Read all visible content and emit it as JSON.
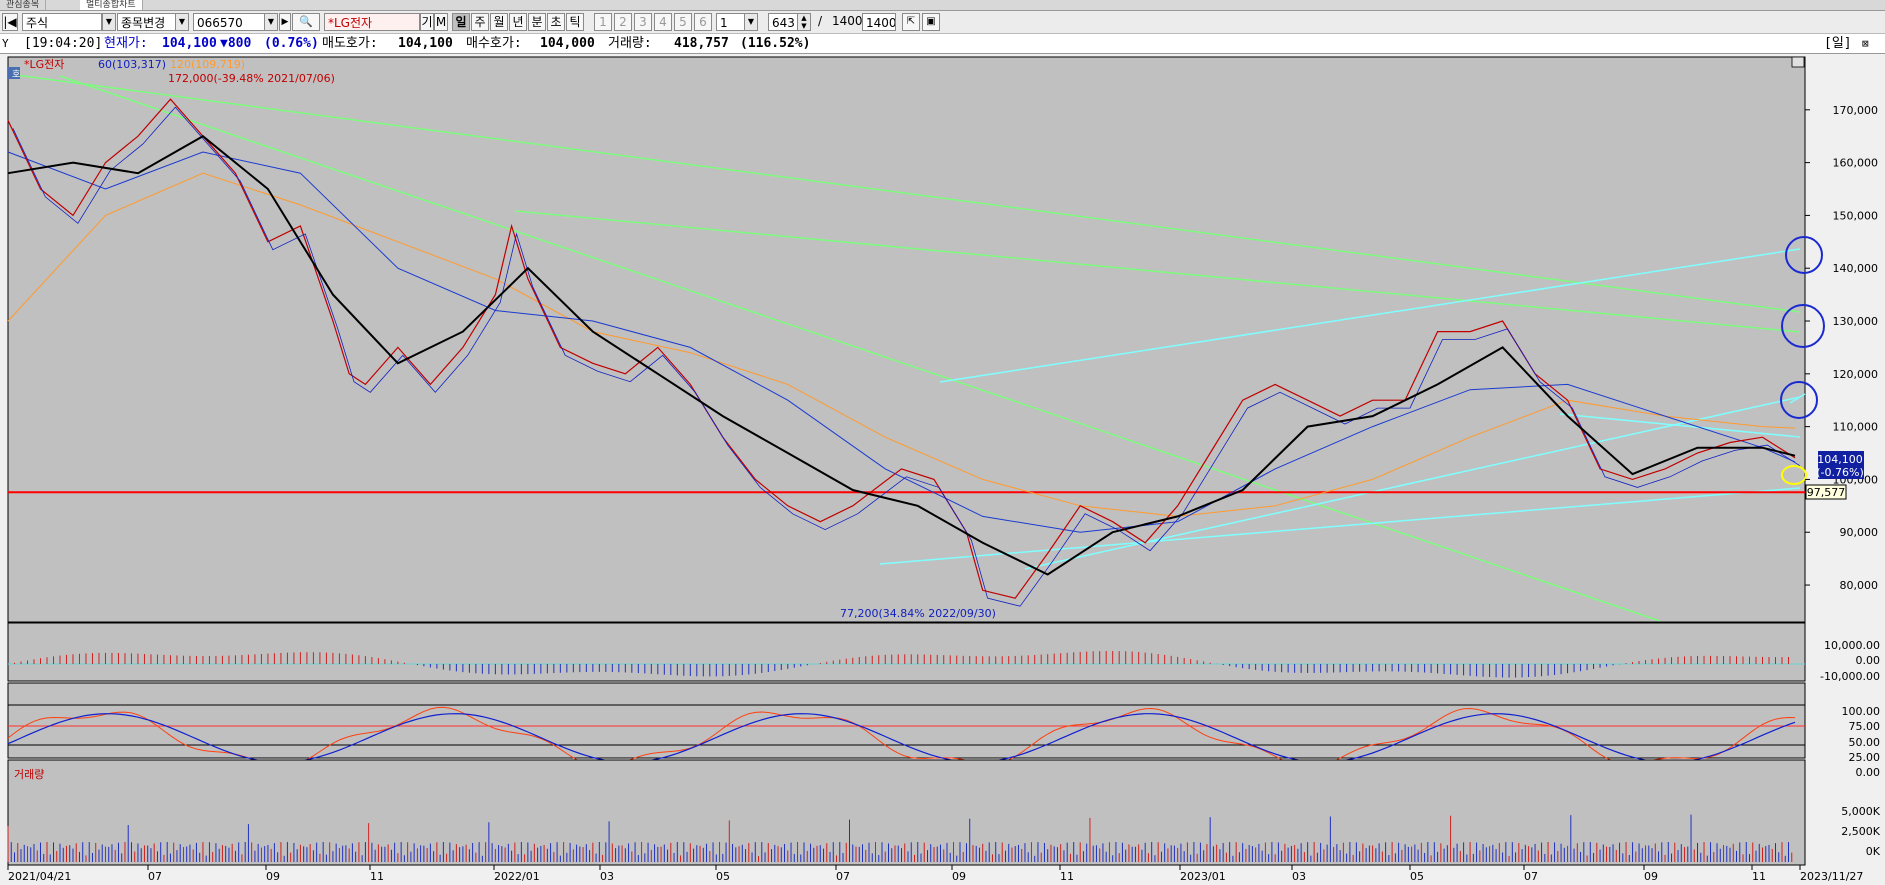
{
  "tabs": [
    "관심종목",
    "멀티종합차트"
  ],
  "toolbar": {
    "market": "주식",
    "change_label": "종목변경",
    "code": "066570",
    "stock_name": "*LG전자",
    "gi": "기",
    "m": "M",
    "periods": [
      "일",
      "주",
      "월",
      "년",
      "분",
      "초",
      "틱"
    ],
    "active_period": "일",
    "nums": [
      "1",
      "2",
      "3",
      "4",
      "5",
      "6"
    ],
    "unit": "1",
    "count": "643",
    "total": "1400",
    "box": "1400"
  },
  "info": {
    "time": "[19:04:20]",
    "price_label": "현재가:",
    "price": "104,100",
    "change": "▼800",
    "change_pct": "(0.76%)",
    "ask_label": "매도호가:",
    "ask": "104,100",
    "bid_label": "매수호가:",
    "bid": "104,000",
    "volume_label": "거래량:",
    "volume": "418,757",
    "volume_pct": "(116.52%)",
    "period_button": "[일]"
  },
  "chart_data": {
    "type": "line",
    "legend": {
      "name": "*LG전자",
      "ma60": "60(103,317)",
      "ma120": "120(109,719)",
      "hi": "172,000(-39.48% 2021/07/06)"
    },
    "hi_marker": "172,000(-39.48% 2021/07/06)",
    "lo_marker": "77,200(34.84% 2022/09/30)",
    "y_ticks": [
      "170,000",
      "160,000",
      "150,000",
      "140,000",
      "130,000",
      "120,000",
      "110,000",
      "100,000",
      "90,000",
      "80,000"
    ],
    "x_ticks": [
      "2021/04/21",
      "07",
      "09",
      "11",
      "2022/01",
      "03",
      "05",
      "07",
      "09",
      "11",
      "2023/01",
      "03",
      "05",
      "07",
      "09",
      "11",
      "2023/11/27"
    ],
    "current_price": "104,100",
    "current_pct": "(-0.76%)",
    "support_label": "97,577",
    "support_line": 97577,
    "ylim": [
      73000,
      180000
    ],
    "price_path": [
      [
        0,
        168000
      ],
      [
        10,
        155000
      ],
      [
        20,
        150000
      ],
      [
        30,
        160000
      ],
      [
        40,
        165000
      ],
      [
        50,
        172000
      ],
      [
        60,
        165000
      ],
      [
        70,
        158000
      ],
      [
        80,
        145000
      ],
      [
        90,
        148000
      ],
      [
        100,
        130000
      ],
      [
        105,
        120000
      ],
      [
        110,
        118000
      ],
      [
        120,
        125000
      ],
      [
        130,
        118000
      ],
      [
        140,
        125000
      ],
      [
        150,
        135000
      ],
      [
        155,
        148000
      ],
      [
        160,
        138000
      ],
      [
        170,
        125000
      ],
      [
        180,
        122000
      ],
      [
        190,
        120000
      ],
      [
        200,
        125000
      ],
      [
        210,
        118000
      ],
      [
        220,
        108000
      ],
      [
        230,
        100000
      ],
      [
        240,
        95000
      ],
      [
        250,
        92000
      ],
      [
        260,
        95000
      ],
      [
        275,
        102000
      ],
      [
        285,
        100000
      ],
      [
        295,
        90000
      ],
      [
        300,
        79000
      ],
      [
        310,
        77500
      ],
      [
        320,
        86000
      ],
      [
        330,
        95000
      ],
      [
        340,
        92000
      ],
      [
        350,
        88000
      ],
      [
        360,
        95000
      ],
      [
        370,
        105000
      ],
      [
        380,
        115000
      ],
      [
        390,
        118000
      ],
      [
        400,
        115000
      ],
      [
        410,
        112000
      ],
      [
        420,
        115000
      ],
      [
        430,
        115000
      ],
      [
        440,
        128000
      ],
      [
        450,
        128000
      ],
      [
        460,
        130000
      ],
      [
        470,
        120000
      ],
      [
        480,
        115000
      ],
      [
        490,
        102000
      ],
      [
        500,
        100000
      ],
      [
        510,
        102000
      ],
      [
        520,
        105000
      ],
      [
        530,
        107000
      ],
      [
        540,
        108000
      ],
      [
        550,
        104100
      ]
    ],
    "ma_black": [
      [
        0,
        158000
      ],
      [
        20,
        160000
      ],
      [
        40,
        158000
      ],
      [
        60,
        165000
      ],
      [
        80,
        155000
      ],
      [
        100,
        135000
      ],
      [
        120,
        122000
      ],
      [
        140,
        128000
      ],
      [
        160,
        140000
      ],
      [
        180,
        128000
      ],
      [
        200,
        120000
      ],
      [
        220,
        112000
      ],
      [
        240,
        105000
      ],
      [
        260,
        98000
      ],
      [
        280,
        95000
      ],
      [
        300,
        88000
      ],
      [
        320,
        82000
      ],
      [
        340,
        90000
      ],
      [
        360,
        93000
      ],
      [
        380,
        98000
      ],
      [
        400,
        110000
      ],
      [
        420,
        112000
      ],
      [
        440,
        118000
      ],
      [
        460,
        125000
      ],
      [
        480,
        112000
      ],
      [
        500,
        101000
      ],
      [
        520,
        106000
      ],
      [
        540,
        106000
      ],
      [
        550,
        104500
      ]
    ],
    "ma60": [
      [
        0,
        162000
      ],
      [
        30,
        155000
      ],
      [
        60,
        162000
      ],
      [
        90,
        158000
      ],
      [
        120,
        140000
      ],
      [
        150,
        132000
      ],
      [
        180,
        130000
      ],
      [
        210,
        125000
      ],
      [
        240,
        115000
      ],
      [
        270,
        102000
      ],
      [
        300,
        93000
      ],
      [
        330,
        90000
      ],
      [
        360,
        92000
      ],
      [
        390,
        102000
      ],
      [
        420,
        110000
      ],
      [
        450,
        117000
      ],
      [
        480,
        118000
      ],
      [
        510,
        112000
      ],
      [
        540,
        106000
      ],
      [
        550,
        103317
      ]
    ],
    "ma120": [
      [
        0,
        130000
      ],
      [
        30,
        150000
      ],
      [
        60,
        158000
      ],
      [
        90,
        152000
      ],
      [
        120,
        145000
      ],
      [
        150,
        138000
      ],
      [
        180,
        128000
      ],
      [
        210,
        124000
      ],
      [
        240,
        118000
      ],
      [
        270,
        108000
      ],
      [
        300,
        100000
      ],
      [
        330,
        95000
      ],
      [
        360,
        93000
      ],
      [
        390,
        95000
      ],
      [
        420,
        100000
      ],
      [
        450,
        108000
      ],
      [
        480,
        115000
      ],
      [
        510,
        112000
      ],
      [
        540,
        110000
      ],
      [
        550,
        109719
      ]
    ],
    "macd_labels": [
      "10,000.00",
      "0.00",
      "-10,000.00"
    ],
    "stoch_labels": [
      "100.00",
      "75.00",
      "50.00",
      "25.00",
      "0.00"
    ],
    "volume_title": "거래량",
    "volume_labels": [
      "5,000K",
      "2,500K",
      "0K"
    ]
  }
}
